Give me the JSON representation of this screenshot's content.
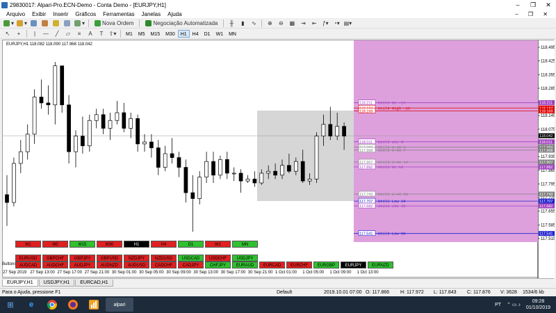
{
  "window": {
    "title": "29830017: Alpari-Pro.ECN-Demo - Conta Demo - [EURJPY,H1]",
    "controls": [
      "–",
      "❐",
      "✕"
    ]
  },
  "menu": {
    "items": [
      "Arquivo",
      "Exibir",
      "Inserir",
      "Gráficos",
      "Ferramentas",
      "Janelas",
      "Ajuda"
    ],
    "right": "– ❐ ✕"
  },
  "toolbar": {
    "new_order": "Nova Ordem",
    "auto_trading": "Negociação Automatizada",
    "timeframes": [
      "M1",
      "M5",
      "M15",
      "M30",
      "H1",
      "H4",
      "D1",
      "W1",
      "MN"
    ],
    "selected_tf": "H1"
  },
  "chart": {
    "symbol_line": "EURJPY,H1  118.082 118.090 117.968 118.042",
    "buttons_label": "Buttons",
    "y_ticks": [
      "118.495",
      "118.425",
      "118.355",
      "118.285",
      "118.215",
      "118.145",
      "118.075",
      "118.005",
      "117.935",
      "117.865",
      "117.795",
      "117.725",
      "117.655",
      "117.585",
      "117.515"
    ],
    "price_tags": [
      {
        "text": "118.211",
        "bg": "#a040c0",
        "fg": "#fff",
        "v": 118.211
      },
      {
        "text": "118.184",
        "bg": "#e00000",
        "fg": "#fff",
        "v": 118.184
      },
      {
        "text": "118.169",
        "bg": "#e00000",
        "fg": "#fff",
        "v": 118.169
      },
      {
        "text": "118.042",
        "bg": "#000000",
        "fg": "#fff",
        "v": 118.042
      },
      {
        "text": "118.011",
        "bg": "#a040c0",
        "fg": "#fff",
        "v": 118.011
      },
      {
        "text": "117.984",
        "bg": "#808080",
        "fg": "#fff",
        "v": 117.984
      },
      {
        "text": "117.968",
        "bg": "#808080",
        "fg": "#fff",
        "v": 117.968
      },
      {
        "text": "117.907",
        "bg": "#808080",
        "fg": "#fff",
        "v": 117.907
      },
      {
        "text": "117.882",
        "bg": "#a040c0",
        "fg": "#fff",
        "v": 117.882
      },
      {
        "text": "117.743",
        "bg": "#808080",
        "fg": "#fff",
        "v": 117.743
      },
      {
        "text": "117.707",
        "bg": "#2020d0",
        "fg": "#fff",
        "v": 117.707
      },
      {
        "text": "117.682",
        "bg": "#a040c0",
        "fg": "#fff",
        "v": 117.682
      },
      {
        "text": "117.541",
        "bg": "#2020d0",
        "fg": "#fff",
        "v": 117.541
      }
    ],
    "levels": [
      {
        "box": "118.211",
        "label": "Util3 6c -17",
        "color": "#a040c0",
        "v": 118.211
      },
      {
        "box": "118.184",
        "label": "Util3 High -15",
        "color": "#e00000",
        "v": 118.184
      },
      {
        "box": "118.169",
        "label": "",
        "color": "#e00000",
        "v": 118.169
      },
      {
        "box": "118.011",
        "label": "Util3 e5c 9",
        "color": "#a040c0",
        "v": 118.011
      },
      {
        "box": "117.984",
        "label": "Util3 H-40 6",
        "color": "#808080",
        "v": 117.984
      },
      {
        "box": "117.968",
        "label": "Util3 H-40 7",
        "color": "#808080",
        "v": 117.968
      },
      {
        "box": "117.907",
        "label": "Util3 H-40 14",
        "color": "#808080",
        "v": 117.907
      },
      {
        "box": "117.882",
        "label": "Util3 6c 16",
        "color": "#a040c0",
        "v": 117.882
      },
      {
        "box": "117.743",
        "label": "Util3 H-40 30",
        "color": "#808080",
        "v": 117.743
      },
      {
        "box": "117.707",
        "label": "Util3 Low 34",
        "color": "#2020d0",
        "v": 117.707
      },
      {
        "box": "117.682",
        "label": "Util3 e5c 36",
        "color": "#a040c0",
        "v": 117.682
      },
      {
        "box": "117.541",
        "label": "Util3 Low 50",
        "color": "#2020d0",
        "v": 117.541
      }
    ],
    "candles": [
      [
        117.74,
        117.84,
        117.58,
        117.7
      ],
      [
        117.7,
        117.93,
        117.68,
        117.9
      ],
      [
        117.9,
        118.02,
        117.85,
        117.96
      ],
      [
        117.96,
        118.1,
        117.92,
        118.05
      ],
      [
        118.05,
        118.28,
        118.0,
        118.24
      ],
      [
        118.24,
        118.33,
        118.18,
        118.21
      ],
      [
        118.21,
        118.3,
        118.15,
        118.2
      ],
      [
        118.2,
        118.42,
        118.1,
        118.4
      ],
      [
        118.4,
        118.38,
        118.16,
        118.2
      ],
      [
        118.2,
        118.25,
        117.9,
        117.96
      ],
      [
        117.96,
        118.07,
        117.88,
        118.04
      ],
      [
        118.04,
        118.14,
        117.95,
        117.99
      ],
      [
        117.99,
        118.15,
        117.96,
        118.12
      ],
      [
        118.12,
        118.18,
        118.08,
        118.15
      ],
      [
        118.15,
        118.18,
        118.05,
        118.08
      ],
      [
        118.08,
        118.16,
        118.02,
        118.12
      ],
      [
        118.12,
        118.22,
        118.1,
        118.16
      ],
      [
        118.16,
        118.21,
        118.06,
        118.08
      ],
      [
        118.08,
        118.16,
        118.03,
        118.13
      ],
      [
        118.13,
        118.15,
        117.96,
        118.0
      ],
      [
        118.0,
        118.05,
        117.96,
        118.01
      ],
      [
        118.01,
        118.05,
        117.93,
        117.98
      ],
      [
        117.98,
        118.02,
        117.84,
        117.88
      ],
      [
        117.88,
        117.99,
        117.86,
        117.95
      ],
      [
        117.95,
        118.03,
        117.9,
        117.93
      ],
      [
        117.93,
        117.96,
        117.83,
        117.88
      ],
      [
        117.88,
        117.92,
        117.7,
        117.75
      ],
      [
        117.75,
        117.84,
        117.55,
        117.72
      ],
      [
        117.72,
        117.86,
        117.69,
        117.83
      ],
      [
        117.83,
        117.96,
        117.8,
        117.91
      ],
      [
        117.91,
        117.96,
        117.8,
        117.84
      ],
      [
        117.84,
        117.94,
        117.82,
        117.92
      ],
      [
        117.92,
        117.96,
        117.82,
        117.85
      ],
      [
        117.85,
        117.88,
        117.81,
        117.85
      ],
      [
        117.85,
        117.87,
        117.75,
        117.81
      ],
      [
        117.81,
        117.84,
        117.8,
        117.82
      ],
      [
        117.82,
        117.86,
        117.78,
        117.8
      ],
      [
        117.8,
        117.87,
        117.79,
        117.85
      ],
      [
        117.85,
        117.89,
        117.82,
        117.86
      ],
      [
        117.86,
        117.9,
        117.82,
        117.84
      ],
      [
        117.84,
        117.92,
        117.82,
        117.89
      ],
      [
        117.89,
        117.95,
        117.85,
        117.86
      ],
      [
        117.86,
        117.93,
        117.84,
        117.91
      ],
      [
        117.91,
        117.97,
        117.8,
        117.81
      ],
      [
        117.81,
        117.85,
        117.79,
        117.82
      ],
      [
        117.82,
        118.06,
        117.8,
        118.04
      ],
      [
        118.04,
        118.15,
        117.99,
        118.1
      ],
      [
        118.1,
        118.19,
        118.02,
        118.04
      ],
      [
        118.04,
        118.16,
        118.02,
        118.09
      ],
      [
        118.09,
        118.11,
        117.97,
        118.04
      ]
    ],
    "time_labels": [
      "27 Sep 2019",
      "27 Sep 13:00",
      "27 Sep 17:00",
      "27 Sep 21:00",
      "30 Sep 01:00",
      "30 Sep 05:00",
      "30 Sep 09:00",
      "30 Sep 13:00",
      "30 Sep 17:00",
      "30 Sep 21:00",
      "1 Oct 01:00",
      "1 Oct 05:00",
      "1 Oct 09:00",
      "1 Oct 13:00"
    ],
    "tf_buttons": [
      {
        "label": "M1",
        "color": "#e02020"
      },
      {
        "label": "M5",
        "color": "#e02020"
      },
      {
        "label": "M15",
        "color": "#30c030"
      },
      {
        "label": "M30",
        "color": "#e02020"
      },
      {
        "label": "H1",
        "color": "#000000"
      },
      {
        "label": "H4",
        "color": "#e02020"
      },
      {
        "label": "D1",
        "color": "#30c030"
      },
      {
        "label": "W1",
        "color": "#e02020"
      },
      {
        "label": "MN",
        "color": "#30c030"
      }
    ],
    "pair_row1": [
      {
        "label": "EURUSD",
        "color": "#e02020"
      },
      {
        "label": "GBPCHF",
        "color": "#e02020"
      },
      {
        "label": "GBPJPY",
        "color": "#e02020"
      },
      {
        "label": "GBPUSD",
        "color": "#e02020"
      },
      {
        "label": "NZDJPY",
        "color": "#e02020"
      },
      {
        "label": "NZDUSD",
        "color": "#e02020"
      },
      {
        "label": "USDCAD",
        "color": "#30c030"
      },
      {
        "label": "USDCHF",
        "color": "#e02020"
      },
      {
        "label": "USDJPY",
        "color": "#30c030"
      }
    ],
    "pair_row2": [
      {
        "label": "AUDCAD",
        "color": "#e02020"
      },
      {
        "label": "AUDCHF",
        "color": "#e02020"
      },
      {
        "label": "AUDJPY",
        "color": "#e02020"
      },
      {
        "label": "AUDNZD",
        "color": "#e02020"
      },
      {
        "label": "AUDUSD",
        "color": "#e02020"
      },
      {
        "label": "CADCHF",
        "color": "#e02020"
      },
      {
        "label": "CADJPY",
        "color": "#e02020"
      },
      {
        "label": "CHFJPY",
        "color": "#30c030"
      },
      {
        "label": "EURAUD",
        "color": "#30c030"
      },
      {
        "label": "EURCAD",
        "color": "#e02020"
      },
      {
        "label": "EURCHF",
        "color": "#e02020"
      },
      {
        "label": "EURGBP",
        "color": "#30c030"
      },
      {
        "label": "EURJPY",
        "color": "#000000"
      },
      {
        "label": "EURNZD",
        "color": "#30c030"
      }
    ]
  },
  "tabs": [
    "EURJPY,H1",
    "USDJPY,H1",
    "EURCAD,H1"
  ],
  "status": {
    "help": "Para o Ajuda, pressione F1",
    "profile": "Default",
    "datetime": "2019.10.01 07:00",
    "open": "O: 117.866",
    "high": "H: 117.972",
    "low": "L: 117.843",
    "close": "C: 117.876",
    "volume": "V: 3628",
    "traffic": "1534/6 kb"
  },
  "taskbar": {
    "apps": [
      "start-icon",
      "ie-icon",
      "chrome-icon",
      "firefox-icon",
      "chart-app-icon",
      "alpari-icon"
    ],
    "alpari_label": "alpari",
    "lang": "PT",
    "time": "09:28",
    "date": "01/10/2019"
  }
}
